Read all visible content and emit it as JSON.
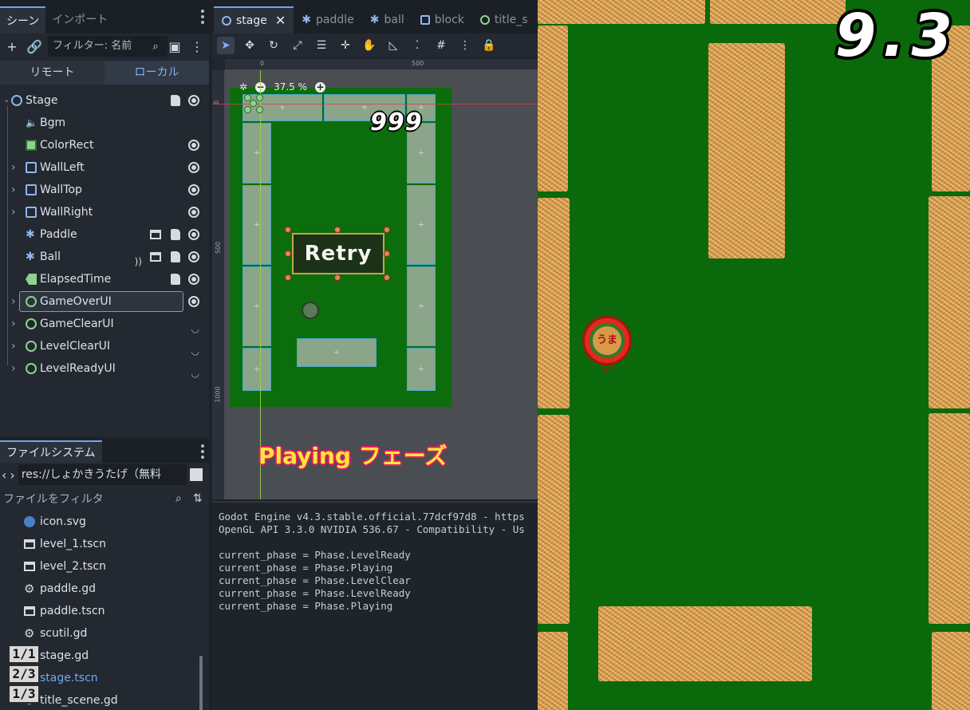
{
  "scene_dock": {
    "tabs": [
      {
        "label": "シーン",
        "active": true
      },
      {
        "label": "インポート",
        "active": false
      }
    ],
    "filter_placeholder": "フィルター: 名前",
    "remote_label": "リモート",
    "local_label": "ローカル",
    "nodes": [
      {
        "name": "Stage",
        "icon": "node-circle-icon",
        "depth": 0,
        "expanded": true,
        "script": true,
        "visible": true
      },
      {
        "name": "Bgm",
        "icon": "speaker-icon",
        "depth": 1
      },
      {
        "name": "ColorRect",
        "icon": "colorrect-icon",
        "depth": 1,
        "visible": true
      },
      {
        "name": "WallLeft",
        "icon": "staticbody-icon",
        "depth": 1,
        "collapsed": true,
        "visible": true
      },
      {
        "name": "WallTop",
        "icon": "staticbody-icon",
        "depth": 1,
        "collapsed": true,
        "visible": true
      },
      {
        "name": "WallRight",
        "icon": "staticbody-icon",
        "depth": 1,
        "collapsed": true,
        "visible": true
      },
      {
        "name": "Paddle",
        "icon": "characterbody-icon",
        "depth": 1,
        "scene": true,
        "script": true,
        "visible": true
      },
      {
        "name": "Ball",
        "icon": "characterbody-icon",
        "depth": 1,
        "signal": true,
        "scene": true,
        "script": true,
        "visible": true
      },
      {
        "name": "ElapsedTime",
        "icon": "label-icon",
        "depth": 1,
        "script": true,
        "visible": true
      },
      {
        "name": "GameOverUI",
        "icon": "control-icon",
        "depth": 1,
        "collapsed": true,
        "visible": true,
        "selected": true
      },
      {
        "name": "GameClearUI",
        "icon": "control-icon",
        "depth": 1,
        "collapsed": true,
        "hidden": true
      },
      {
        "name": "LevelClearUI",
        "icon": "control-icon",
        "depth": 1,
        "collapsed": true,
        "hidden": true
      },
      {
        "name": "LevelReadyUI",
        "icon": "control-icon",
        "depth": 1,
        "collapsed": true,
        "hidden": true
      }
    ]
  },
  "filesystem": {
    "tab_label": "ファイルシステム",
    "path": "res://しょかきうたげ（無料",
    "filter_placeholder": "ファイルをフィルタ",
    "files": [
      {
        "name": "icon.svg",
        "icon": "svg-icon"
      },
      {
        "name": "level_1.tscn",
        "icon": "scene-file-icon"
      },
      {
        "name": "level_2.tscn",
        "icon": "scene-file-icon"
      },
      {
        "name": "paddle.gd",
        "icon": "gear-icon"
      },
      {
        "name": "paddle.tscn",
        "icon": "scene-file-icon"
      },
      {
        "name": "scutil.gd",
        "icon": "gear-icon"
      },
      {
        "name": "stage.gd",
        "icon": "gear-icon"
      },
      {
        "name": "stage.tscn",
        "icon": "scene-file-icon",
        "active": true
      },
      {
        "name": "title_scene.gd",
        "icon": "gear-icon"
      }
    ],
    "badges": [
      "1/1",
      "2/3",
      "1/3"
    ]
  },
  "editor": {
    "tabs": [
      {
        "label": "stage",
        "active": true
      },
      {
        "label": "paddle"
      },
      {
        "label": "ball"
      },
      {
        "label": "block"
      },
      {
        "label": "title_s"
      }
    ],
    "zoom": "37.5 %",
    "ruler_labels": {
      "h0": "0",
      "h500": "500",
      "v0": "0",
      "v500": "500",
      "v1000": "1000"
    },
    "mini_score": "999",
    "retry_label": "Retry",
    "phase_label": "Playing フェーズ"
  },
  "output": {
    "lines": [
      "Godot Engine v4.3.stable.official.77dcf97d8 - https",
      "OpenGL API 3.3.0 NVIDIA 536.67 - Compatibility - Us",
      "",
      "current_phase = Phase.LevelReady",
      "current_phase = Phase.Playing",
      "current_phase = Phase.LevelClear",
      "current_phase = Phase.LevelReady",
      "current_phase = Phase.Playing"
    ]
  },
  "game": {
    "elapsed_time": "9.3",
    "ball_text": "うまい"
  },
  "colors": {
    "accent": "#6aa7ef",
    "field_green": "#0a6a0b",
    "straw": "#d69a48",
    "phase_yellow": "#ffe53b",
    "phase_pink": "#e31d63"
  }
}
